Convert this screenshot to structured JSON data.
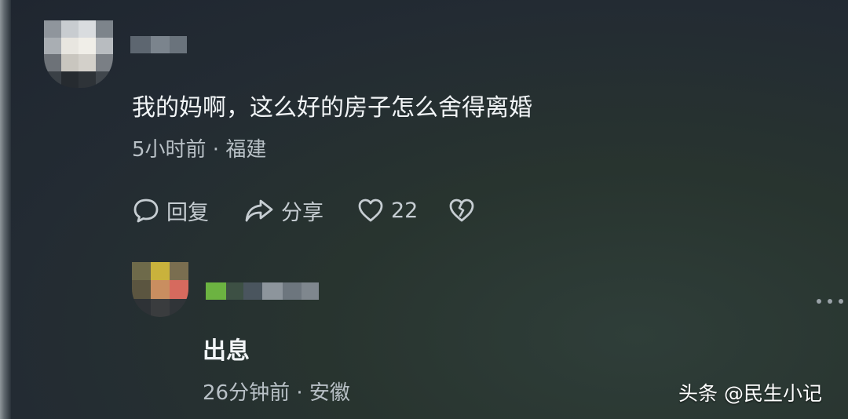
{
  "comments": [
    {
      "text": "我的妈啊，这么好的房子怎么舍得离婚",
      "meta": "5小时前 · 福建",
      "actions": {
        "reply_label": "回复",
        "share_label": "分享",
        "like_count": "22"
      }
    },
    {
      "text": "出息",
      "meta": "26分钟前 · 安徽"
    }
  ],
  "watermark": "头条 @民生小记",
  "icons": {
    "reply": "chat-bubble-icon",
    "share": "share-arrow-icon",
    "like": "heart-icon",
    "dislike": "broken-heart-icon",
    "more": "more-dots-icon"
  },
  "colors": {
    "background": "#232b33",
    "text_primary": "#f1f4f6",
    "text_secondary": "#b8c0c6"
  }
}
